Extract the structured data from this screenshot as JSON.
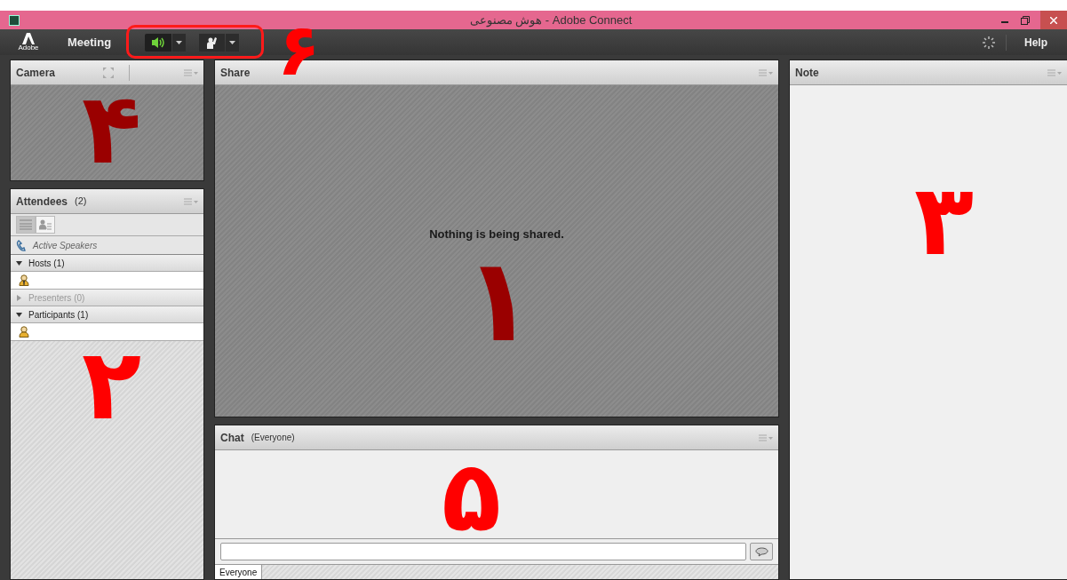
{
  "window": {
    "title": "هوش مصنوعی - Adobe Connect"
  },
  "menu_bar": {
    "logo_text": "Adobe",
    "menu": "Meeting",
    "audio_on": true,
    "help": "Help",
    "annotation": "۶"
  },
  "camera": {
    "title": "Camera",
    "annotation": "۴"
  },
  "attendees": {
    "title": "Attendees",
    "count": "(2)",
    "views": [
      {
        "selected": true
      },
      {
        "selected": false
      }
    ],
    "active_speakers": "Active Speakers",
    "groups": [
      {
        "label": "Hosts (1)",
        "expanded": true,
        "members": [
          {
            "kind": "host"
          }
        ]
      },
      {
        "label": "Presenters (0)",
        "expanded": false
      },
      {
        "label": "Participants (1)",
        "expanded": true,
        "members": [
          {
            "kind": "participant"
          }
        ]
      }
    ],
    "annotation": "۲"
  },
  "share": {
    "title": "Share",
    "message": "Nothing is being shared.",
    "annotation": "۱"
  },
  "chat": {
    "title": "Chat",
    "scope": "(Everyone)",
    "annotation": "۵",
    "tabs": [
      {
        "label": "Everyone",
        "selected": true
      }
    ]
  },
  "note": {
    "title": "Note",
    "annotation": "۳"
  }
}
